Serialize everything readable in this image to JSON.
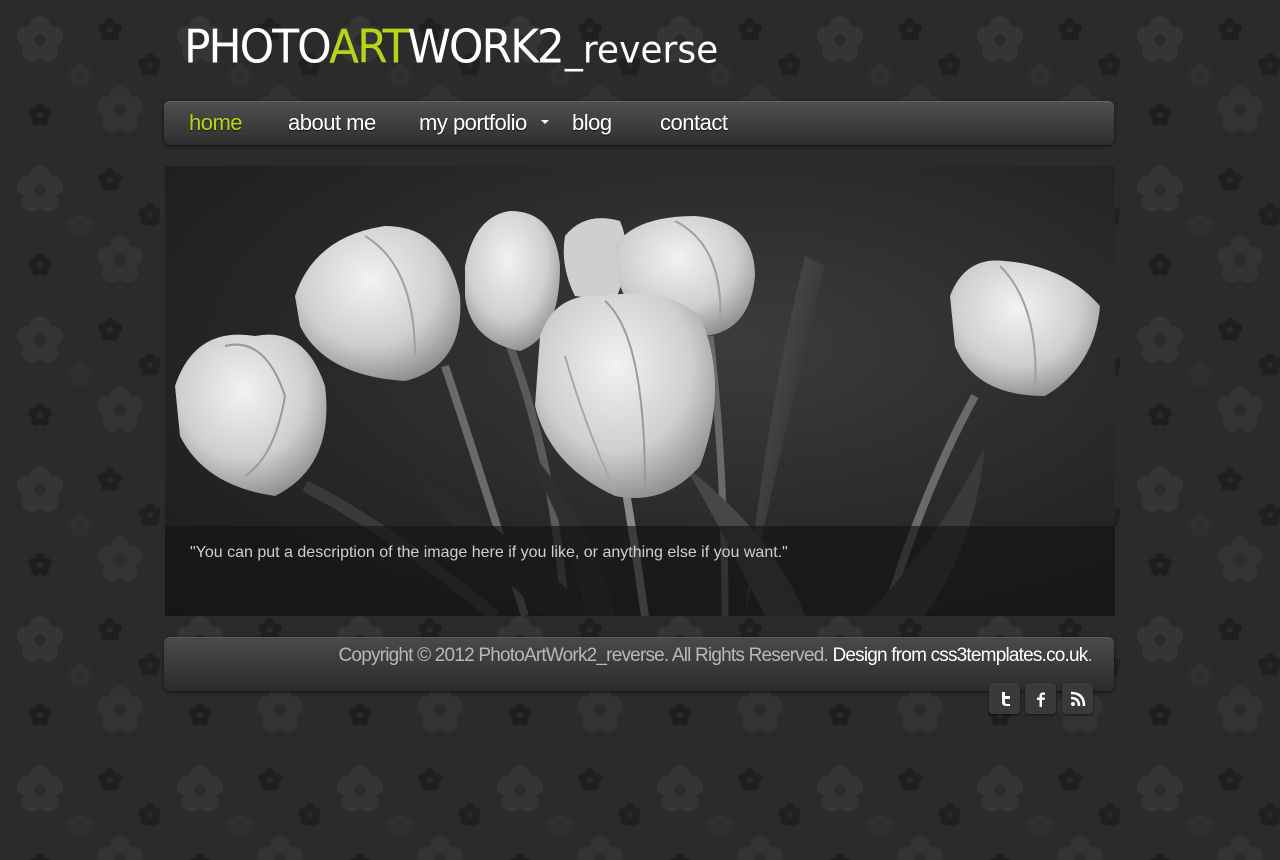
{
  "logo": {
    "part1": "PHOTO",
    "part2": "ART",
    "part3": "WORK2",
    "part4": "_reverse"
  },
  "nav": {
    "items": [
      {
        "label": "home",
        "active": true
      },
      {
        "label": "about me"
      },
      {
        "label": "my portfolio",
        "has_dropdown": true
      },
      {
        "label": "blog"
      },
      {
        "label": "contact"
      }
    ]
  },
  "hero": {
    "caption": "\"You can put a description of the image here if you like, or anything else if you want.\""
  },
  "footer": {
    "copyright": "Copyright © 2012 PhotoArtWork2_reverse. All Rights Reserved.",
    "design_link": "Design from css3templates.co.uk",
    "trailing": "."
  },
  "social": {
    "icons": [
      "twitter-icon",
      "facebook-icon",
      "rss-icon"
    ]
  },
  "colors": {
    "accent": "#b8d41a",
    "background": "#2a2a2a"
  }
}
